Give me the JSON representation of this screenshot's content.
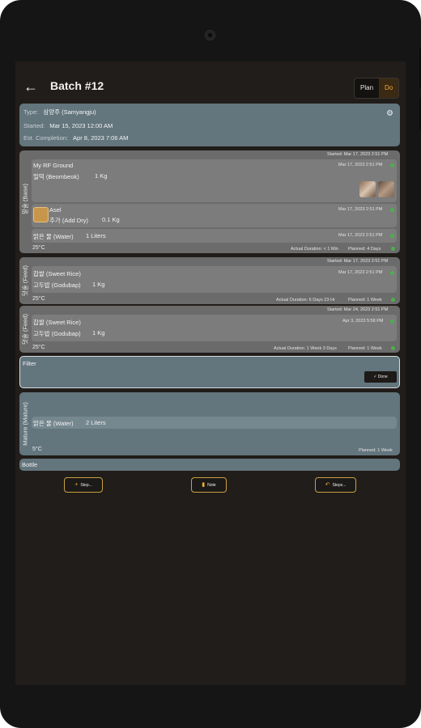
{
  "header": {
    "back_icon": "arrow-left-icon",
    "title": "Batch #12",
    "toggle_plan": "Plan",
    "toggle_do": "Do"
  },
  "info": {
    "type_label": "Type:",
    "type_value": "삼양주 (Samyangju)",
    "started_label": "Started:",
    "started_value": "Mar 15, 2023 12:00 AM",
    "completion_label": "Est. Completion:",
    "completion_value": "Apr 8, 2023 7:06 AM",
    "settings_icon": "gear-icon"
  },
  "stages": {
    "base": {
      "label": "밑술 (Base)",
      "started": "Started: Mar 17, 2023 2:51 PM",
      "items": [
        {
          "title": "My RF Ground",
          "name": "밀떡 (Beombeok)",
          "qty": "1 Kg",
          "time": "Mar 17, 2023 2:51 PM"
        },
        {
          "title": "Asel",
          "name": "추가 (Add Dry)",
          "qty": "0.1 Kg",
          "time": "Mar 17, 2023 2:51 PM"
        },
        {
          "name": "맑은 물 (Water)",
          "qty": "1 Liters",
          "time": "Mar 17, 2023 2:51 PM"
        }
      ],
      "temp": "25°C",
      "duration": "Actual Duration: < 1 Min",
      "planned": "Planned: 4 Days"
    },
    "feed1": {
      "label": "덧술 (Feed)",
      "started": "Started: Mar 17, 2023 2:51 PM",
      "line1": "찹쌀 (Sweet Rice)",
      "line2_name": "고두밥 (Godubap)",
      "line2_qty": "1 Kg",
      "time": "Mar 17, 2023 2:51 PM",
      "temp": "25°C",
      "duration": "Actual Duration: 6 Days 23 Hr",
      "planned": "Planned: 1 Week"
    },
    "feed2": {
      "label": "덧술 (Feed)",
      "started": "Started: Mar 24, 2023 2:51 PM",
      "line1": "찹쌀 (Sweet Rice)",
      "line2_name": "고두밥 (Godubap)",
      "line2_qty": "1 Kg",
      "time": "Apr 3, 2023 5:58 PM",
      "temp": "25°C",
      "duration": "Actual Duration: 1 Week 3 Days",
      "planned": "Planned: 1 Week"
    },
    "filter": {
      "label": "Filter",
      "done": "Done",
      "done_icon": "check-icon"
    },
    "mature": {
      "label": "Mature (Mature)",
      "item_name": "맑은 물 (Water)",
      "item_qty": "2 Liters",
      "temp": "5°C",
      "planned": "Planned: 1 Week"
    },
    "bottle": {
      "label": "Bottle"
    }
  },
  "actions": {
    "step_label": "Step...",
    "note_label": "Note",
    "steps_label": "Steps..."
  },
  "colors": {
    "accent": "#f2a53a",
    "card": "#63757d",
    "status": "#4cb04c"
  }
}
